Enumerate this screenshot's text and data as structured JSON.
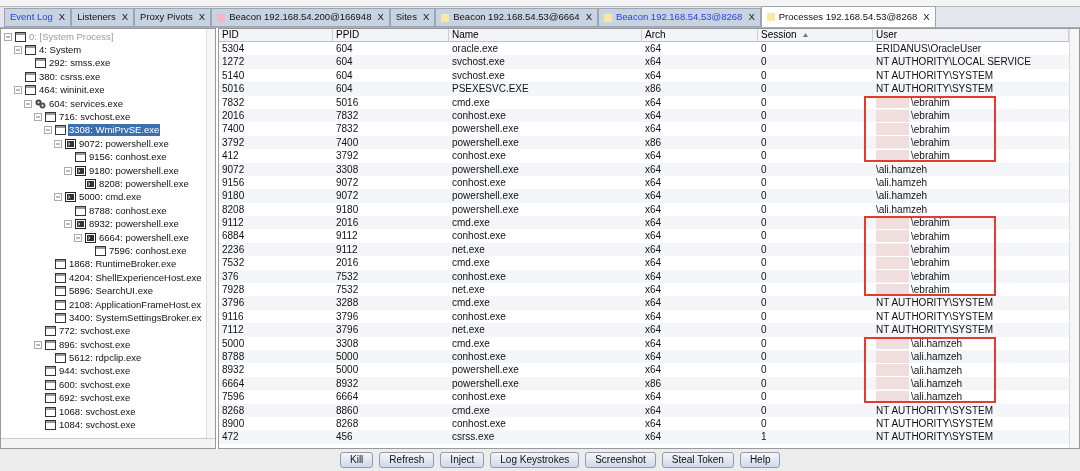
{
  "tabs": [
    {
      "label": "Event Log",
      "selected": false,
      "highlighted": true,
      "close": "X"
    },
    {
      "label": "Listeners",
      "selected": false,
      "highlighted": false,
      "close": "X"
    },
    {
      "label": "Proxy Pivots",
      "selected": false,
      "highlighted": false,
      "close": "X"
    },
    {
      "label": "Beacon 192.168.54.200@166948",
      "selected": false,
      "highlighted": false,
      "close": "X",
      "color": "#f4b6c2"
    },
    {
      "label": "Sites",
      "selected": false,
      "highlighted": false,
      "close": "X"
    },
    {
      "label": "Beacon 192.168.54.53@6664",
      "selected": false,
      "highlighted": false,
      "close": "X",
      "color": "#fbe7a1"
    },
    {
      "label": "Beacon 192.168.54.53@8268",
      "selected": false,
      "highlighted": true,
      "close": "X",
      "color": "#fbe7a1"
    },
    {
      "label": "Processes 192.168.54.53@8268",
      "selected": true,
      "highlighted": false,
      "close": "X",
      "color": "#fbe7a1"
    }
  ],
  "tree": [
    {
      "label": "0: [System Process]",
      "kind": "window",
      "greyed": true,
      "selected": false,
      "children": [
        {
          "label": "4: System",
          "kind": "window",
          "greyed": false,
          "selected": false,
          "children": [
            {
              "label": "292: smss.exe",
              "kind": "window",
              "greyed": false,
              "selected": false
            }
          ]
        },
        {
          "label": "380: csrss.exe",
          "kind": "window",
          "greyed": false,
          "selected": false
        },
        {
          "label": "464: wininit.exe",
          "kind": "window",
          "greyed": false,
          "selected": false,
          "children": [
            {
              "label": "604: services.exe",
              "kind": "gears",
              "greyed": false,
              "selected": false,
              "children": [
                {
                  "label": "716: svchost.exe",
                  "kind": "window",
                  "greyed": false,
                  "selected": false,
                  "children": [
                    {
                      "label": "3308: WmiPrvSE.exe",
                      "kind": "window",
                      "greyed": false,
                      "selected": true,
                      "children": [
                        {
                          "label": "9072: powershell.exe",
                          "kind": "console",
                          "greyed": false,
                          "selected": false,
                          "children": [
                            {
                              "label": "9156: conhost.exe",
                              "kind": "window",
                              "greyed": false,
                              "selected": false
                            },
                            {
                              "label": "9180: powershell.exe",
                              "kind": "console",
                              "greyed": false,
                              "selected": false,
                              "children": [
                                {
                                  "label": "8208: powershell.exe",
                                  "kind": "console",
                                  "greyed": false,
                                  "selected": false
                                }
                              ]
                            }
                          ]
                        },
                        {
                          "label": "5000: cmd.exe",
                          "kind": "console",
                          "greyed": false,
                          "selected": false,
                          "children": [
                            {
                              "label": "8788: conhost.exe",
                              "kind": "window",
                              "greyed": false,
                              "selected": false
                            },
                            {
                              "label": "8932: powershell.exe",
                              "kind": "console",
                              "greyed": false,
                              "selected": false,
                              "children": [
                                {
                                  "label": "6664: powershell.exe",
                                  "kind": "console",
                                  "greyed": false,
                                  "selected": false,
                                  "children": [
                                    {
                                      "label": "7596: conhost.exe",
                                      "kind": "window",
                                      "greyed": false,
                                      "selected": false
                                    }
                                  ]
                                }
                              ]
                            }
                          ]
                        }
                      ]
                    },
                    {
                      "label": "1868: RuntimeBroker.exe",
                      "kind": "window",
                      "greyed": false,
                      "selected": false
                    },
                    {
                      "label": "4204: ShellExperienceHost.exe",
                      "kind": "window",
                      "greyed": false,
                      "selected": false
                    },
                    {
                      "label": "5896: SearchUI.exe",
                      "kind": "window",
                      "greyed": false,
                      "selected": false
                    },
                    {
                      "label": "2108: ApplicationFrameHost.ex",
                      "kind": "window",
                      "greyed": false,
                      "selected": false
                    },
                    {
                      "label": "3400: SystemSettingsBroker.ex",
                      "kind": "window",
                      "greyed": false,
                      "selected": false
                    }
                  ]
                },
                {
                  "label": "772: svchost.exe",
                  "kind": "window",
                  "greyed": false,
                  "selected": false
                },
                {
                  "label": "896: svchost.exe",
                  "kind": "window",
                  "greyed": false,
                  "selected": false,
                  "children": [
                    {
                      "label": "5612: rdpclip.exe",
                      "kind": "window",
                      "greyed": false,
                      "selected": false
                    }
                  ]
                },
                {
                  "label": "944: svchost.exe",
                  "kind": "window",
                  "greyed": false,
                  "selected": false
                },
                {
                  "label": "600: svchost.exe",
                  "kind": "window",
                  "greyed": false,
                  "selected": false
                },
                {
                  "label": "692: svchost.exe",
                  "kind": "window",
                  "greyed": false,
                  "selected": false
                },
                {
                  "label": "1068: svchost.exe",
                  "kind": "window",
                  "greyed": false,
                  "selected": false
                },
                {
                  "label": "1084: svchost.exe",
                  "kind": "window",
                  "greyed": false,
                  "selected": false
                }
              ]
            }
          ]
        }
      ]
    }
  ],
  "table": {
    "columns": [
      {
        "label": "PID",
        "sorted": false
      },
      {
        "label": "PPID",
        "sorted": false
      },
      {
        "label": "Name",
        "sorted": false
      },
      {
        "label": "Arch",
        "sorted": false
      },
      {
        "label": "Session",
        "sorted": true
      },
      {
        "label": "User",
        "sorted": false
      }
    ],
    "rows": [
      {
        "cells": [
          "5304",
          "604",
          "oracle.exe",
          "x64",
          "0",
          "ERIDANUS\\OracleUser"
        ],
        "marked": false
      },
      {
        "cells": [
          "1272",
          "604",
          "svchost.exe",
          "x64",
          "0",
          "NT AUTHORITY\\LOCAL SERVICE"
        ],
        "marked": false
      },
      {
        "cells": [
          "5140",
          "604",
          "svchost.exe",
          "x64",
          "0",
          "NT AUTHORITY\\SYSTEM"
        ],
        "marked": false
      },
      {
        "cells": [
          "5016",
          "604",
          "PSEXESVC.EXE",
          "x86",
          "0",
          "NT AUTHORITY\\SYSTEM"
        ],
        "marked": false
      },
      {
        "cells": [
          "7832",
          "5016",
          "cmd.exe",
          "x64",
          "0",
          "\\ebrahim"
        ],
        "marked": true
      },
      {
        "cells": [
          "2016",
          "7832",
          "conhost.exe",
          "x64",
          "0",
          "\\ebrahim"
        ],
        "marked": true
      },
      {
        "cells": [
          "7400",
          "7832",
          "powershell.exe",
          "x64",
          "0",
          "\\ebrahim"
        ],
        "marked": true
      },
      {
        "cells": [
          "3792",
          "7400",
          "powershell.exe",
          "x86",
          "0",
          "\\ebrahim"
        ],
        "marked": true
      },
      {
        "cells": [
          "412",
          "3792",
          "conhost.exe",
          "x64",
          "0",
          "\\ebrahim"
        ],
        "marked": true
      },
      {
        "cells": [
          "9072",
          "3308",
          "powershell.exe",
          "x64",
          "0",
          "\\ali.hamzeh"
        ],
        "marked": false
      },
      {
        "cells": [
          "9156",
          "9072",
          "conhost.exe",
          "x64",
          "0",
          "\\ali.hamzeh"
        ],
        "marked": false
      },
      {
        "cells": [
          "9180",
          "9072",
          "powershell.exe",
          "x64",
          "0",
          "\\ali.hamzeh"
        ],
        "marked": false
      },
      {
        "cells": [
          "8208",
          "9180",
          "powershell.exe",
          "x64",
          "0",
          "\\ali.hamzeh"
        ],
        "marked": false
      },
      {
        "cells": [
          "9112",
          "2016",
          "cmd.exe",
          "x64",
          "0",
          "\\ebrahim"
        ],
        "marked": true
      },
      {
        "cells": [
          "6884",
          "9112",
          "conhost.exe",
          "x64",
          "0",
          "\\ebrahim"
        ],
        "marked": true
      },
      {
        "cells": [
          "2236",
          "9112",
          "net.exe",
          "x64",
          "0",
          "\\ebrahim"
        ],
        "marked": true
      },
      {
        "cells": [
          "7532",
          "2016",
          "cmd.exe",
          "x64",
          "0",
          "\\ebrahim"
        ],
        "marked": true
      },
      {
        "cells": [
          "376",
          "7532",
          "conhost.exe",
          "x64",
          "0",
          "\\ebrahim"
        ],
        "marked": true
      },
      {
        "cells": [
          "7928",
          "7532",
          "net.exe",
          "x64",
          "0",
          "\\ebrahim"
        ],
        "marked": true
      },
      {
        "cells": [
          "3796",
          "3288",
          "cmd.exe",
          "x64",
          "0",
          "NT AUTHORITY\\SYSTEM"
        ],
        "marked": false
      },
      {
        "cells": [
          "9116",
          "3796",
          "conhost.exe",
          "x64",
          "0",
          "NT AUTHORITY\\SYSTEM"
        ],
        "marked": false
      },
      {
        "cells": [
          "7112",
          "3796",
          "net.exe",
          "x64",
          "0",
          "NT AUTHORITY\\SYSTEM"
        ],
        "marked": false
      },
      {
        "cells": [
          "5000",
          "3308",
          "cmd.exe",
          "x64",
          "0",
          "\\ali.hamzeh"
        ],
        "marked": true
      },
      {
        "cells": [
          "8788",
          "5000",
          "conhost.exe",
          "x64",
          "0",
          "\\ali.hamzeh"
        ],
        "marked": true
      },
      {
        "cells": [
          "8932",
          "5000",
          "powershell.exe",
          "x64",
          "0",
          "\\ali.hamzeh"
        ],
        "marked": true
      },
      {
        "cells": [
          "6664",
          "8932",
          "powershell.exe",
          "x86",
          "0",
          "\\ali.hamzeh"
        ],
        "marked": true
      },
      {
        "cells": [
          "7596",
          "6664",
          "conhost.exe",
          "x64",
          "0",
          "\\ali.hamzeh"
        ],
        "marked": true
      },
      {
        "cells": [
          "8268",
          "8860",
          "cmd.exe",
          "x64",
          "0",
          "NT AUTHORITY\\SYSTEM"
        ],
        "marked": false
      },
      {
        "cells": [
          "8900",
          "8268",
          "conhost.exe",
          "x64",
          "0",
          "NT AUTHORITY\\SYSTEM"
        ],
        "marked": false
      },
      {
        "cells": [
          "472",
          "456",
          "csrss.exe",
          "x64",
          "1",
          "NT AUTHORITY\\SYSTEM"
        ],
        "marked": false
      }
    ]
  },
  "buttons": [
    "Kill",
    "Refresh",
    "Inject",
    "Log Keystrokes",
    "Screenshot",
    "Steal Token",
    "Help"
  ]
}
